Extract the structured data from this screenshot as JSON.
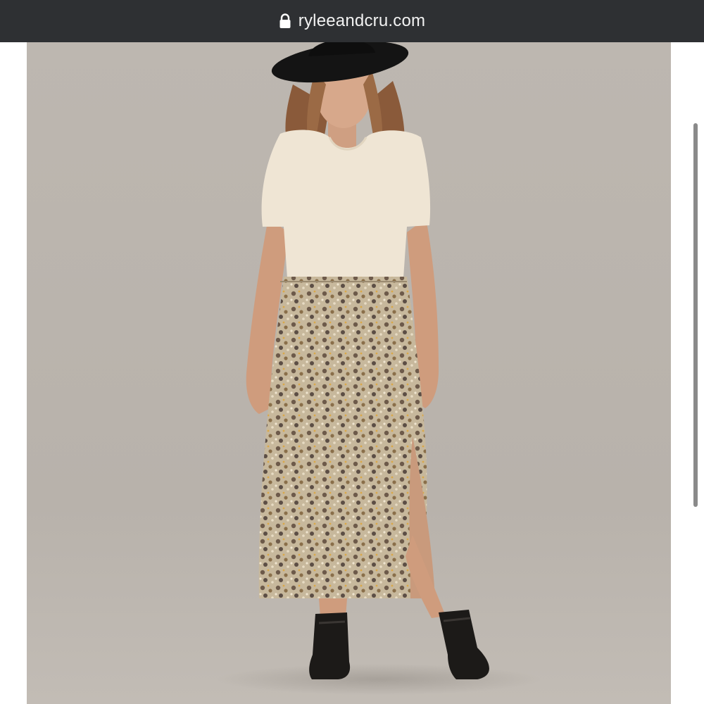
{
  "browser": {
    "url": "ryleeandcru.com",
    "lock_icon": "lock-icon"
  },
  "product_image": {
    "subject": "model-photo"
  },
  "colors": {
    "toolbar_bg": "#2e3033",
    "backdrop": "#b9b3ac",
    "top": "#efe6d6",
    "skirt": "#b4a48a",
    "boots": "#1c1a18",
    "hat": "#141414"
  }
}
